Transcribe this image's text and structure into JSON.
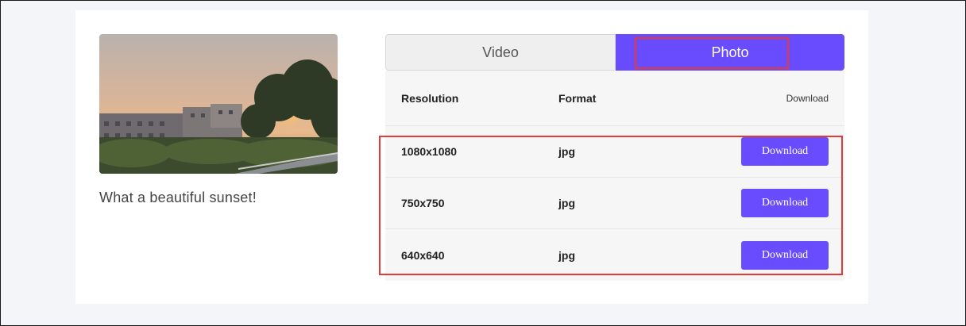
{
  "media": {
    "caption": "What a beautiful sunset!",
    "thumbnail_icon": "sunset-photo"
  },
  "tabs": [
    {
      "label": "Video",
      "active": false
    },
    {
      "label": "Photo",
      "active": true
    }
  ],
  "table": {
    "headers": {
      "resolution": "Resolution",
      "format": "Format",
      "download": "Download"
    },
    "rows": [
      {
        "resolution": "1080x1080",
        "format": "jpg",
        "button": "Download"
      },
      {
        "resolution": "750x750",
        "format": "jpg",
        "button": "Download"
      },
      {
        "resolution": "640x640",
        "format": "jpg",
        "button": "Download"
      }
    ]
  },
  "colors": {
    "accent": "#6a4cff",
    "highlight": "#e53935",
    "page_bg": "#f4f5f9"
  }
}
